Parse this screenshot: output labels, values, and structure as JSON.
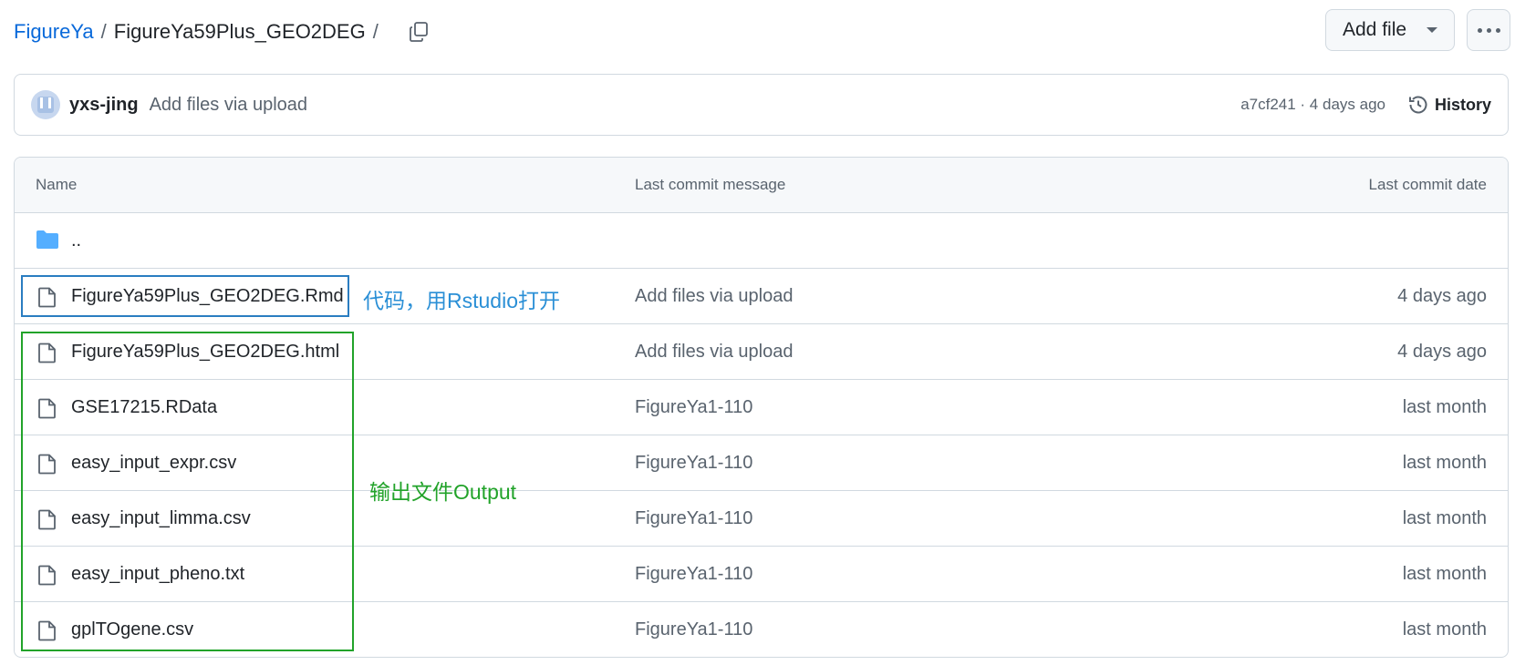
{
  "breadcrumb": {
    "repo": "FigureYa",
    "separator": "/",
    "folder": "FigureYa59Plus_GEO2DEG",
    "trailing_separator": "/"
  },
  "actions": {
    "add_file_label": "Add file",
    "more_icon": "kebab-horizontal-icon",
    "copy_icon": "copy-icon"
  },
  "commit": {
    "author": "yxs-jing",
    "message": "Add files via upload",
    "meta": "a7cf241 · 4 days ago",
    "history_label": "History",
    "history_icon": "history-icon"
  },
  "table": {
    "headers": {
      "name": "Name",
      "message": "Last commit message",
      "date": "Last commit date"
    },
    "parent": {
      "name": "..",
      "icon": "folder-icon"
    },
    "files": [
      {
        "name": "FigureYa59Plus_GEO2DEG.Rmd",
        "message": "Add files via upload",
        "date": "4 days ago",
        "icon": "file-icon"
      },
      {
        "name": "FigureYa59Plus_GEO2DEG.html",
        "message": "Add files via upload",
        "date": "4 days ago",
        "icon": "file-icon"
      },
      {
        "name": "GSE17215.RData",
        "message": "FigureYa1-110",
        "date": "last month",
        "icon": "file-icon"
      },
      {
        "name": "easy_input_expr.csv",
        "message": "FigureYa1-110",
        "date": "last month",
        "icon": "file-icon"
      },
      {
        "name": "easy_input_limma.csv",
        "message": "FigureYa1-110",
        "date": "last month",
        "icon": "file-icon"
      },
      {
        "name": "easy_input_pheno.txt",
        "message": "FigureYa1-110",
        "date": "last month",
        "icon": "file-icon"
      },
      {
        "name": "gplTOgene.csv",
        "message": "FigureYa1-110",
        "date": "last month",
        "icon": "file-icon"
      }
    ]
  },
  "annotations": {
    "code_note": "代码，用Rstudio打开",
    "output_note": "输出文件Output",
    "code_color": "#2a8fd6",
    "output_color": "#22a32a"
  },
  "colors": {
    "link": "#0969da",
    "border": "#d1d9e0",
    "muted": "#59636e",
    "folder": "#54aeff"
  }
}
